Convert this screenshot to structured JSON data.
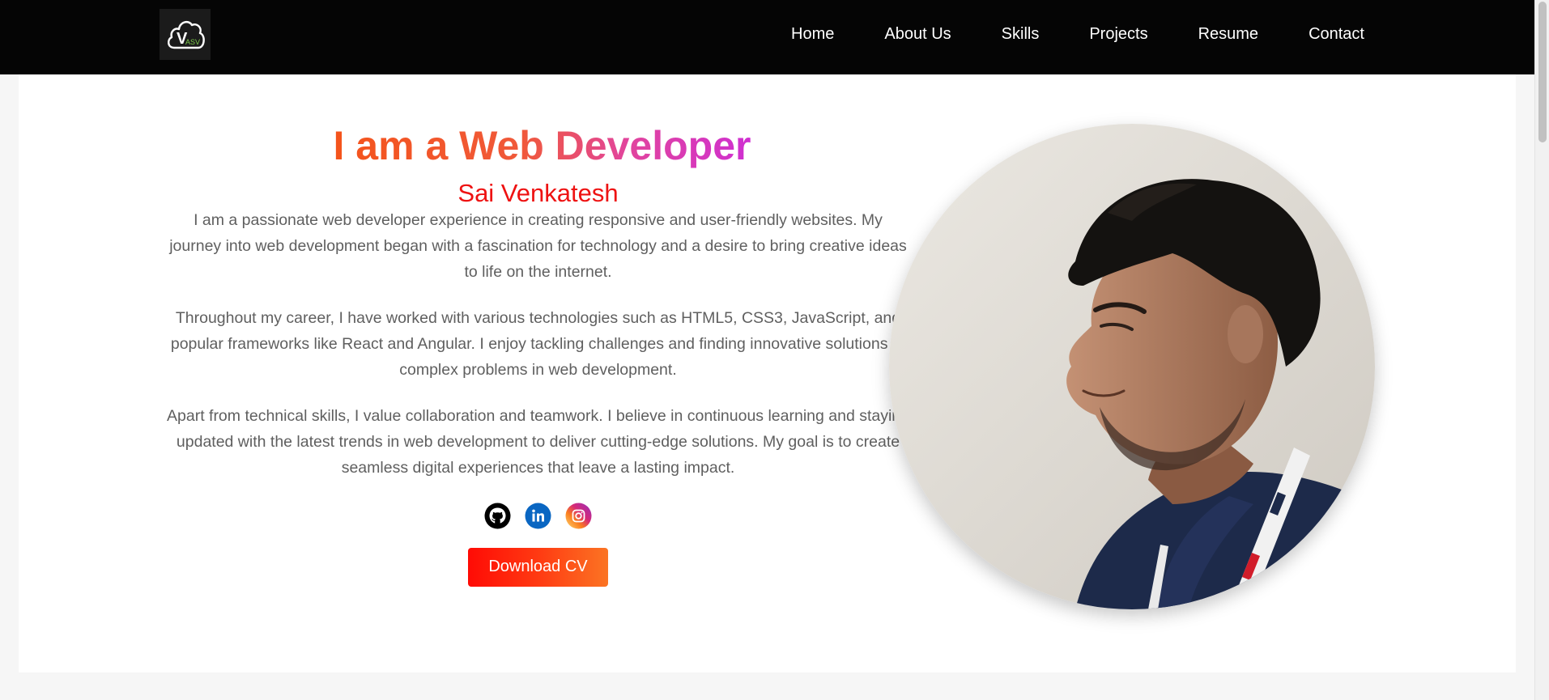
{
  "header": {
    "logo": {
      "letters": "V",
      "sub_letters": "ASV"
    },
    "nav": [
      {
        "label": "Home"
      },
      {
        "label": "About Us"
      },
      {
        "label": "Skills"
      },
      {
        "label": "Projects"
      },
      {
        "label": "Resume"
      },
      {
        "label": "Contact"
      }
    ]
  },
  "hero": {
    "headline": "I am a Web Developer",
    "name": "Sai Venkatesh",
    "paragraphs": [
      "I am a passionate web developer experience in creating responsive and user-friendly websites. My journey into web development began with a fascination for technology and a desire to bring creative ideas to life on the internet.",
      "Throughout my career, I have worked with various technologies such as HTML5, CSS3, JavaScript, and popular frameworks like React and Angular. I enjoy tackling challenges and finding innovative solutions to complex problems in web development.",
      "Apart from technical skills, I value collaboration and teamwork. I believe in continuous learning and staying updated with the latest trends in web development to deliver cutting-edge solutions. My goal is to create seamless digital experiences that leave a lasting impact."
    ],
    "socials": [
      {
        "icon": "github-icon",
        "color": "#000000"
      },
      {
        "icon": "linkedin-icon",
        "color": "#0a66c2"
      },
      {
        "icon": "instagram-icon",
        "color": "#e1306c"
      }
    ],
    "download_label": "Download CV"
  },
  "colors": {
    "navbar": "#050505",
    "name_red": "#ee1212",
    "gradient_start": "#f4541b",
    "gradient_end": "#cf2fd1",
    "button_start": "#ff0b05",
    "button_end": "#fb7423"
  }
}
